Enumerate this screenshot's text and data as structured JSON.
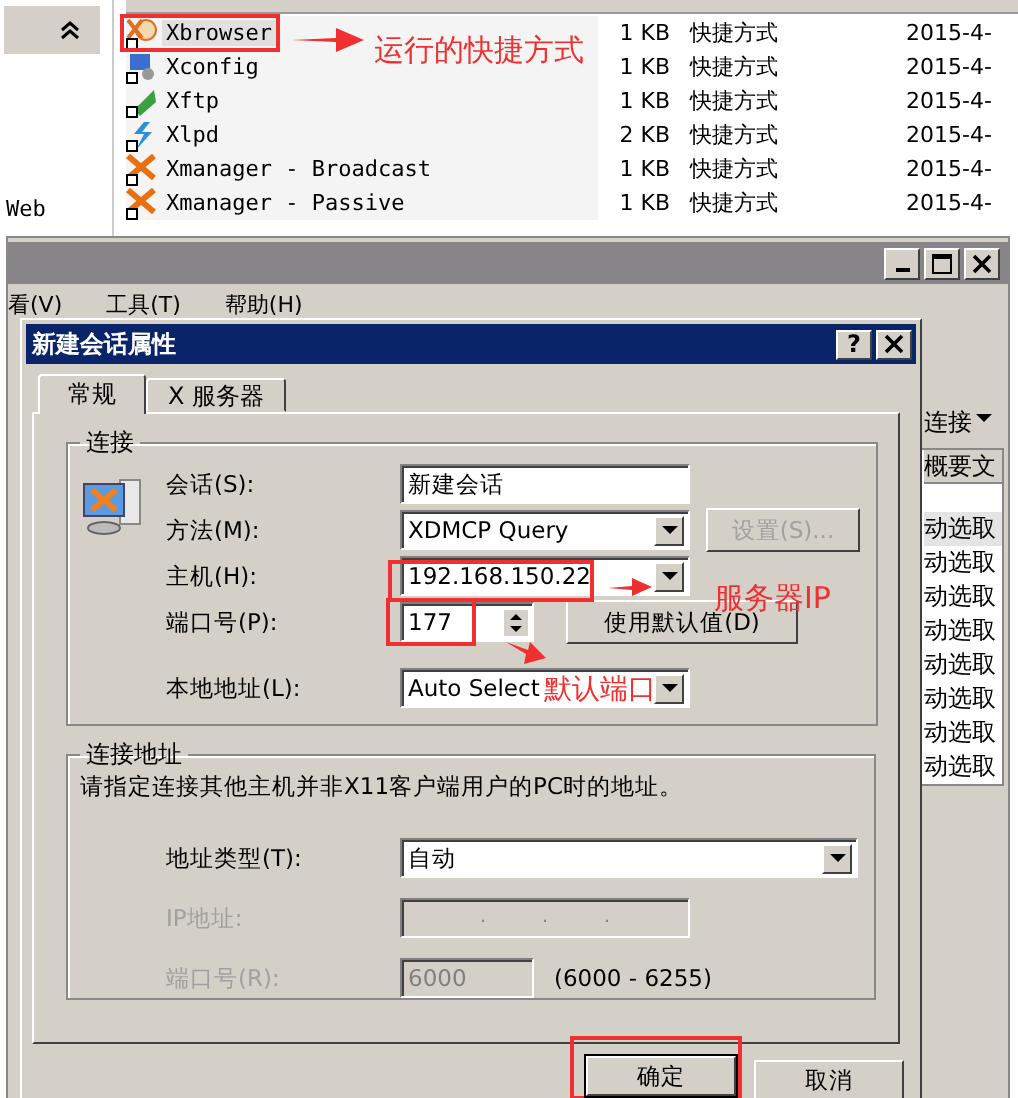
{
  "explorer": {
    "sidebar": [
      {
        "label": "Web"
      }
    ],
    "files": [
      {
        "name": "Xbrowser",
        "size": "1 KB",
        "type": "快捷方式",
        "date": "2015-4-",
        "selected": true,
        "kind": "browser"
      },
      {
        "name": "Xconfig",
        "size": "1 KB",
        "type": "快捷方式",
        "date": "2015-4-",
        "selected": false,
        "kind": "config"
      },
      {
        "name": "Xftp",
        "size": "1 KB",
        "type": "快捷方式",
        "date": "2015-4-",
        "selected": false,
        "kind": "ftp"
      },
      {
        "name": "Xlpd",
        "size": "2 KB",
        "type": "快捷方式",
        "date": "2015-4-",
        "selected": false,
        "kind": "lpd"
      },
      {
        "name": "Xmanager - Broadcast",
        "size": "1 KB",
        "type": "快捷方式",
        "date": "2015-4-",
        "selected": false,
        "kind": "manager"
      },
      {
        "name": "Xmanager - Passive",
        "size": "1 KB",
        "type": "快捷方式",
        "date": "2015-4-",
        "selected": false,
        "kind": "manager"
      }
    ]
  },
  "main_window": {
    "menu": [
      "看(V)",
      "工具(T)",
      "帮助(H)"
    ],
    "panel": {
      "header": "连接",
      "column": "概要文",
      "rows": [
        {
          "text": "动选取",
          "selected": true
        },
        {
          "text": "动选取",
          "selected": false
        },
        {
          "text": "动选取",
          "selected": false
        },
        {
          "text": "动选取",
          "selected": false
        },
        {
          "text": "动选取",
          "selected": false
        },
        {
          "text": "动选取",
          "selected": false
        },
        {
          "text": "动选取",
          "selected": false
        },
        {
          "text": "动选取",
          "selected": false
        }
      ]
    }
  },
  "dialog": {
    "title": "新建会话属性",
    "help": "?",
    "tabs": [
      {
        "label": "常规",
        "selected": true
      },
      {
        "label": "X 服务器",
        "selected": false
      }
    ],
    "connection": {
      "title": "连接",
      "fields": [
        {
          "label": "会话(S):",
          "kind": "text",
          "value": "新建会话"
        },
        {
          "label": "方法(M):",
          "kind": "combo",
          "value": "XDMCP Query",
          "button": {
            "label": "设置(S)...",
            "disabled": true
          }
        },
        {
          "label": "主机(H):",
          "kind": "combo",
          "value": "192.168.150.22"
        },
        {
          "label": "端口号(P):",
          "kind": "spin",
          "value": "177",
          "button": {
            "label": "使用默认值(D)",
            "disabled": false
          }
        },
        {
          "label": "本地地址(L):",
          "kind": "combo",
          "value": "Auto Select"
        }
      ]
    },
    "address": {
      "title": "连接地址",
      "description": "请指定连接其他主机并非X11客户端用户的PC时的地址。",
      "fields": [
        {
          "label": "地址类型(T):",
          "kind": "combo",
          "value": "自动",
          "disabled": false
        },
        {
          "label": "IP地址:",
          "kind": "ip",
          "separators": [
            ".",
            ".",
            "."
          ],
          "disabled": true
        },
        {
          "label": "端口号(R):",
          "kind": "text",
          "value": "6000",
          "disabled": true,
          "range": "(6000 - 6255)"
        }
      ]
    },
    "buttons": [
      {
        "label": "确定",
        "default": true
      },
      {
        "label": "取消",
        "default": false
      }
    ]
  },
  "annotations": [
    {
      "text": "运行的快捷方式"
    },
    {
      "text": "服务器IP"
    },
    {
      "text": "默认端口"
    }
  ]
}
